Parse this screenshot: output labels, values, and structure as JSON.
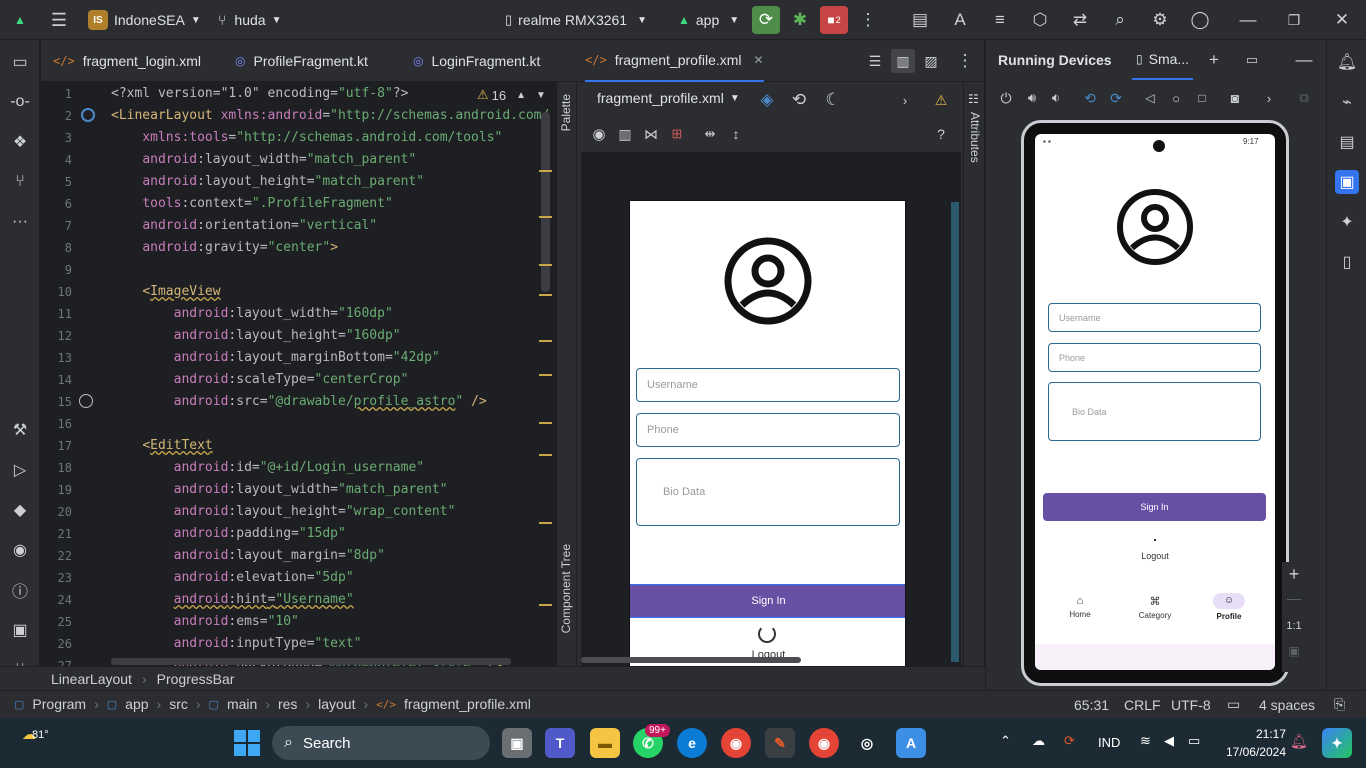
{
  "titlebar": {
    "project_badge": "IS",
    "project_name": "IndoneSEA",
    "branch": "huda",
    "device": "realme RMX3261",
    "run_config": "app",
    "device_badge_count": "2"
  },
  "tabs": [
    {
      "label": "fragment_login.xml",
      "type": "xml"
    },
    {
      "label": "ProfileFragment.kt",
      "type": "kt"
    },
    {
      "label": "LoginFragment.kt",
      "type": "kt"
    },
    {
      "label": "fragment_profile.xml",
      "type": "xml",
      "active": true
    }
  ],
  "editor": {
    "warning_count": "16",
    "lines": [
      {
        "n": "1",
        "html": "<span class='pi'>&lt;?xml version=\"1.0\" encoding=<span class='val'>\"utf-8\"</span>?&gt;</span>"
      },
      {
        "n": "2",
        "html": "<span class='tag'>&lt;LinearLayout</span> <span class='attr-ns'>xmlns:android</span>=<span class='val'>\"http://schemas.android.com/</span>"
      },
      {
        "n": "3",
        "html": "    <span class='attr-ns'>xmlns:tools</span>=<span class='val'>\"http://schemas.android.com/tools\"</span>"
      },
      {
        "n": "4",
        "html": "    <span class='attr-ns'>android</span>:<span class='attr'>layout_width</span>=<span class='val'>\"match_parent\"</span>"
      },
      {
        "n": "5",
        "html": "    <span class='attr-ns'>android</span>:<span class='attr'>layout_height</span>=<span class='val'>\"match_parent\"</span>"
      },
      {
        "n": "6",
        "html": "    <span class='attr-ns'>tools</span>:<span class='attr'>context</span>=<span class='val'>\".ProfileFragment\"</span>"
      },
      {
        "n": "7",
        "html": "    <span class='attr-ns'>android</span>:<span class='attr'>orientation</span>=<span class='val'>\"vertical\"</span>"
      },
      {
        "n": "8",
        "html": "    <span class='attr-ns'>android</span>:<span class='attr'>gravity</span>=<span class='val'>\"center\"</span><span class='tag'>&gt;</span>"
      },
      {
        "n": "9",
        "html": ""
      },
      {
        "n": "10",
        "html": "    <span class='tag'>&lt;<span class='warn-u'>ImageView</span></span>"
      },
      {
        "n": "11",
        "html": "        <span class='attr-ns'>android</span>:<span class='attr'>layout_width</span>=<span class='val'>\"160dp\"</span>"
      },
      {
        "n": "12",
        "html": "        <span class='attr-ns'>android</span>:<span class='attr'>layout_height</span>=<span class='val'>\"160dp\"</span>"
      },
      {
        "n": "13",
        "html": "        <span class='attr-ns'>android</span>:<span class='attr'>layout_marginBottom</span>=<span class='val'>\"42dp\"</span>"
      },
      {
        "n": "14",
        "html": "        <span class='attr-ns'>android</span>:<span class='attr'>scaleType</span>=<span class='val'>\"centerCrop\"</span>"
      },
      {
        "n": "15",
        "html": "        <span class='attr-ns'>android</span>:<span class='attr'>src</span>=<span class='val'>\"@drawable/<span class='warn-u'>profile_astro</span>\"</span> <span class='tag'>/&gt;</span>"
      },
      {
        "n": "16",
        "html": ""
      },
      {
        "n": "17",
        "html": "    <span class='tag'>&lt;<span class='warn-u'>EditText</span></span>"
      },
      {
        "n": "18",
        "html": "        <span class='attr-ns'>android</span>:<span class='attr'>id</span>=<span class='val'>\"@+id/Login_username\"</span>"
      },
      {
        "n": "19",
        "html": "        <span class='attr-ns'>android</span>:<span class='attr'>layout_width</span>=<span class='val'>\"match_parent\"</span>"
      },
      {
        "n": "20",
        "html": "        <span class='attr-ns'>android</span>:<span class='attr'>layout_height</span>=<span class='val'>\"wrap_content\"</span>"
      },
      {
        "n": "21",
        "html": "        <span class='attr-ns'>android</span>:<span class='attr'>padding</span>=<span class='val'>\"15dp\"</span>"
      },
      {
        "n": "22",
        "html": "        <span class='attr-ns'>android</span>:<span class='attr'>layout_margin</span>=<span class='val'>\"8dp\"</span>"
      },
      {
        "n": "23",
        "html": "        <span class='attr-ns'>android</span>:<span class='attr'>elevation</span>=<span class='val'>\"5dp\"</span>"
      },
      {
        "n": "24",
        "html": "        <span class='warn-u'><span class='attr-ns'>android</span>:<span class='attr'>hint</span>=<span class='val'>\"Username\"</span></span>"
      },
      {
        "n": "25",
        "html": "        <span class='attr-ns'>android</span>:<span class='attr'>ems</span>=<span class='val'>\"10\"</span>"
      },
      {
        "n": "26",
        "html": "        <span class='attr-ns'>android</span>:<span class='attr'>inputType</span>=<span class='val'>\"text\"</span>"
      },
      {
        "n": "27",
        "html": "        <span class='attr-ns'>android</span>:<span class='attr'>background</span>=<span class='val'>\"@drawable/et_style\"</span> <span class='tag'>/&gt;</span>"
      }
    ]
  },
  "design": {
    "file": "fragment_profile.xml",
    "palette_label": "Palette",
    "component_tree_label": "Component Tree",
    "attributes_label": "Attributes",
    "preview": {
      "username_hint": "Username",
      "phone_hint": "Phone",
      "bio_hint": "Bio Data",
      "signin": "Sign In",
      "logout": "Logout"
    }
  },
  "running": {
    "title": "Running Devices",
    "tab": "Sma...",
    "phone_time": "9:17",
    "zoom_label": "1:1",
    "screen": {
      "username_hint": "Username",
      "phone_hint": "Phone",
      "bio_hint": "Bio Data",
      "signin": "Sign In",
      "logout": "Logout",
      "nav": [
        "Home",
        "Category",
        "Profile"
      ]
    }
  },
  "statusbar": {
    "breadcrumb": [
      "LinearLayout",
      "ProgressBar"
    ]
  },
  "pathbar": {
    "items": [
      "Program",
      "app",
      "src",
      "main",
      "res",
      "layout",
      "fragment_profile.xml"
    ],
    "position": "65:31",
    "line_ending": "CRLF",
    "encoding": "UTF-8",
    "indent": "4 spaces"
  },
  "taskbar": {
    "weather": "81°",
    "search": "Search",
    "whatsapp_badge": "99+",
    "lang": "IND",
    "time": "21:17",
    "date": "17/06/2024"
  },
  "colors": {
    "accent": "#3574f0",
    "signin": "#6750a4",
    "field_border": "#2a6b8f"
  }
}
